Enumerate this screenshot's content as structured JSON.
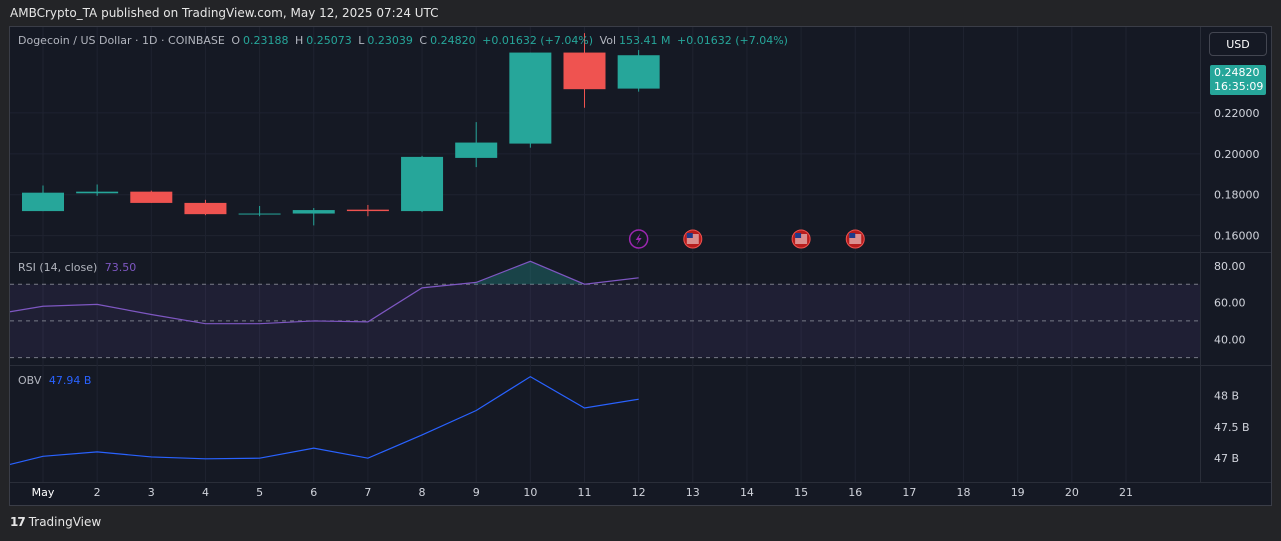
{
  "header": {
    "published": "AMBCrypto_TA published on TradingView.com, May 12, 2025 07:24 UTC"
  },
  "legend": {
    "symbol": "Dogecoin / US Dollar · 1D · COINBASE",
    "o_label": "O",
    "o_value": "0.23188",
    "h_label": "H",
    "h_value": "0.25073",
    "l_label": "L",
    "l_value": "0.23039",
    "c_label": "C",
    "c_value": "0.24820",
    "change": "+0.01632 (+7.04%)",
    "vol_label": "Vol",
    "vol_value": "153.41 M",
    "vol_change": "+0.01632 (+7.04%)"
  },
  "currency_button": "USD",
  "price_tag": {
    "price": "0.24820",
    "countdown": "16:35:09"
  },
  "rsi": {
    "label": "RSI (14, close)",
    "value": "73.50"
  },
  "obv": {
    "label": "OBV",
    "value": "47.94 B"
  },
  "footer": {
    "brand": "TradingView"
  },
  "colors": {
    "up": "#26a69a",
    "down": "#ef5350",
    "rsi": "#7e57c2",
    "obv": "#2962ff",
    "background": "#151924"
  },
  "chart_data": [
    {
      "type": "candlestick",
      "x_labels": [
        "May",
        "2",
        "3",
        "4",
        "5",
        "6",
        "7",
        "8",
        "9",
        "10",
        "11",
        "12",
        "13",
        "14",
        "15",
        "16",
        "17",
        "18",
        "19",
        "20",
        "21"
      ],
      "price_ticks": [
        "0.22000",
        "0.20000",
        "0.18000",
        "0.16000"
      ],
      "ylim": [
        0.152,
        0.262
      ],
      "candles": [
        {
          "x": "May",
          "o": 0.172,
          "h": 0.1845,
          "l": 0.172,
          "c": 0.181
        },
        {
          "x": "2",
          "o": 0.1807,
          "h": 0.185,
          "l": 0.1795,
          "c": 0.1815
        },
        {
          "x": "3",
          "o": 0.1815,
          "h": 0.182,
          "l": 0.176,
          "c": 0.176
        },
        {
          "x": "4",
          "o": 0.176,
          "h": 0.1775,
          "l": 0.17,
          "c": 0.1705
        },
        {
          "x": "5",
          "o": 0.1705,
          "h": 0.1745,
          "l": 0.1695,
          "c": 0.1708
        },
        {
          "x": "6",
          "o": 0.1708,
          "h": 0.1735,
          "l": 0.165,
          "c": 0.1725
        },
        {
          "x": "7",
          "o": 0.1727,
          "h": 0.175,
          "l": 0.1695,
          "c": 0.172
        },
        {
          "x": "8",
          "o": 0.172,
          "h": 0.199,
          "l": 0.1715,
          "c": 0.1985
        },
        {
          "x": "9",
          "o": 0.198,
          "h": 0.2155,
          "l": 0.1935,
          "c": 0.2055
        },
        {
          "x": "10",
          "o": 0.205,
          "h": 0.2495,
          "l": 0.203,
          "c": 0.2495
        },
        {
          "x": "11",
          "o": 0.2495,
          "h": 0.259,
          "l": 0.2225,
          "c": 0.2316
        },
        {
          "x": "12",
          "o": 0.23188,
          "h": 0.25073,
          "l": 0.23039,
          "c": 0.2482
        }
      ],
      "events": [
        {
          "x": "12",
          "icon": "lightning-icon"
        },
        {
          "x": "13",
          "icon": "us-flag-icon"
        },
        {
          "x": "15",
          "icon": "us-flag-icon"
        },
        {
          "x": "16",
          "icon": "us-flag-icon"
        }
      ]
    },
    {
      "type": "line",
      "name": "RSI (14, close)",
      "x": [
        "May",
        "2",
        "3",
        "4",
        "5",
        "6",
        "7",
        "8",
        "9",
        "10",
        "11",
        "12"
      ],
      "y": [
        58,
        59,
        53.5,
        48.5,
        48.5,
        50,
        49.5,
        68,
        71,
        82.5,
        70,
        73.5
      ],
      "ticks": [
        "80.00",
        "60.00",
        "40.00"
      ],
      "levels": [
        70,
        50,
        30
      ],
      "ylim": [
        26,
        87
      ]
    },
    {
      "type": "line",
      "name": "OBV",
      "x": [
        "May",
        "2",
        "3",
        "4",
        "5",
        "6",
        "7",
        "8",
        "9",
        "10",
        "11",
        "12"
      ],
      "y": [
        47.03,
        47.1,
        47.02,
        46.99,
        47.0,
        47.16,
        47.0,
        47.37,
        47.76,
        48.3,
        47.8,
        47.94
      ],
      "ticks": [
        "48 B",
        "47.5 B",
        "47 B"
      ],
      "ylim": [
        46.62,
        48.47
      ]
    }
  ]
}
